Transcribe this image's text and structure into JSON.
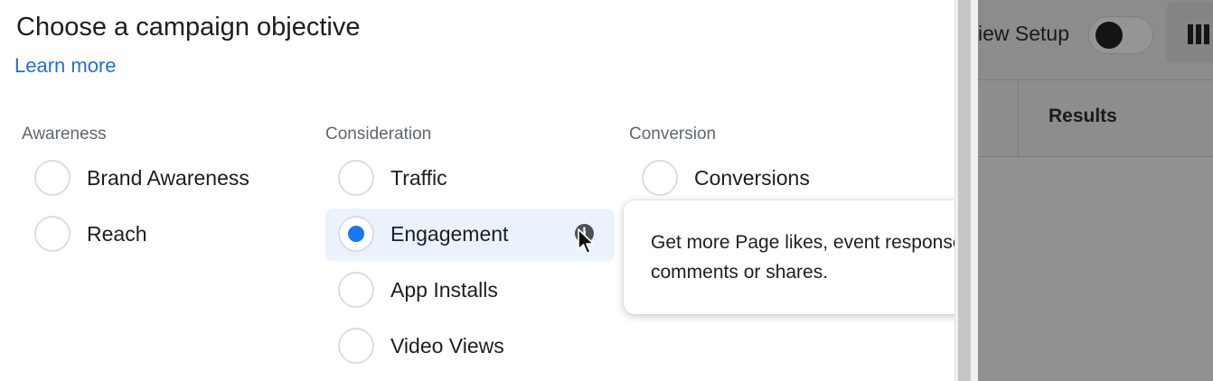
{
  "dialog": {
    "title": "Choose a campaign objective",
    "learn_more": "Learn more"
  },
  "columns": [
    {
      "heading": "Awareness",
      "options": [
        {
          "label": "Brand Awareness",
          "selected": false
        },
        {
          "label": "Reach",
          "selected": false
        }
      ]
    },
    {
      "heading": "Consideration",
      "options": [
        {
          "label": "Traffic",
          "selected": false
        },
        {
          "label": "Engagement",
          "selected": true
        },
        {
          "label": "App Installs",
          "selected": false
        },
        {
          "label": "Video Views",
          "selected": false
        }
      ]
    },
    {
      "heading": "Conversion",
      "options": [
        {
          "label": "Conversions",
          "selected": false
        }
      ]
    }
  ],
  "tooltip": {
    "text": "Get more Page likes, event responses, or post reacts, comments or shares."
  },
  "background": {
    "view_setup_label": "iew Setup",
    "toggle_on": false,
    "columns_icon": "columns-icon",
    "results_header": "Results"
  },
  "icons": {
    "info": "info-icon",
    "cursor": "cursor-icon"
  },
  "colors": {
    "accent": "#1877f2",
    "link": "#216fdb",
    "selected_bg": "#ebf2fd"
  }
}
